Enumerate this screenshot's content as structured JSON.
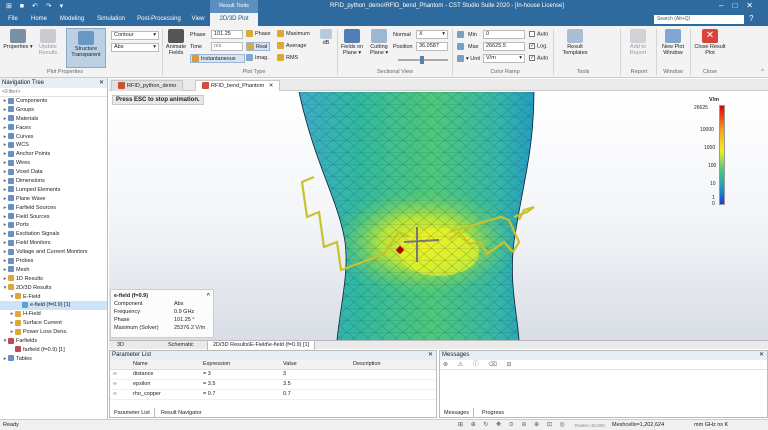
{
  "window": {
    "title": "RFID_python_demo\\RFID_bend_Phantom - CST Studio Suite 2020 - [In-house License]",
    "context_tab": "Result Tools",
    "quick_access": "⊞ ■ ↶ ↷ ▾"
  },
  "menu": {
    "tabs": [
      "File",
      "Home",
      "Modeling",
      "Simulation",
      "Post-Processing",
      "View",
      "2D/3D Plot"
    ],
    "search_placeholder": "Search (Alt+Q)"
  },
  "ribbon": {
    "plot_properties": {
      "properties": "Properties",
      "update_results": "Update Results",
      "structure_transparent": "Structure Transparent",
      "plot_type_select": "Contour",
      "scale_select": "Abs",
      "group": "Plot Properties"
    },
    "plot_type": {
      "animate_fields": "Animate Fields",
      "phase_label": "Phase",
      "phase_value": "101.25",
      "time_label": "Time",
      "time_value": "n/s",
      "instantaneous": "Instantaneous",
      "phase_btn": "Phase",
      "real_btn": "Real",
      "imag_btn": "Imag.",
      "maximum_btn": "Maximum",
      "average_btn": "Average",
      "rms_btn": "RMS",
      "db_btn": "dB",
      "group": "Plot Type"
    },
    "sectional_view": {
      "fields_on_plane": "Fields on Plane",
      "cutting_plane": "Cutting Plane",
      "normal_label": "Normal",
      "normal_value": "X",
      "position_label": "Position",
      "position_value": "36.0587",
      "group": "Sectional View"
    },
    "color_ramp": {
      "min_label": "Min",
      "min_value": "0",
      "max_label": "Max",
      "max_value": "26625.5",
      "unit_label": "Unit",
      "unit_value": "V/m",
      "auto_label": "Auto",
      "log_label": "Log.",
      "log_checked": true,
      "auto2_label": "Auto",
      "auto2_checked": true,
      "group": "Color Ramp"
    },
    "tools": {
      "result_templates": "Result Templates",
      "group": "Tools"
    },
    "report": {
      "add_to_report": "Add to Report",
      "group": "Report"
    },
    "window": {
      "new_plot_window": "New Plot Window",
      "group": "Window"
    },
    "close": {
      "close_result_plot": "Close Result Plot",
      "group": "Close"
    }
  },
  "navtree": {
    "title": "Navigation Tree",
    "filter": "<Filter>",
    "items": [
      {
        "label": "Components",
        "color": "#6b8fc2"
      },
      {
        "label": "Groups",
        "color": "#6b8fc2"
      },
      {
        "label": "Materials",
        "color": "#6b8fc2"
      },
      {
        "label": "Faces",
        "color": "#6b8fc2"
      },
      {
        "label": "Curves",
        "color": "#6b8fc2"
      },
      {
        "label": "WCS",
        "color": "#6b8fc2"
      },
      {
        "label": "Anchor Points",
        "color": "#6b8fc2"
      },
      {
        "label": "Wires",
        "color": "#6b8fc2"
      },
      {
        "label": "Voxel Data",
        "color": "#6b8fc2"
      },
      {
        "label": "Dimensions",
        "color": "#6b8fc2"
      },
      {
        "label": "Lumped Elements",
        "color": "#6b8fc2"
      },
      {
        "label": "Plane Wave",
        "color": "#6b8fc2"
      },
      {
        "label": "Farfield Sources",
        "color": "#6b8fc2"
      },
      {
        "label": "Field Sources",
        "color": "#6b8fc2"
      },
      {
        "label": "Ports",
        "color": "#6b8fc2"
      },
      {
        "label": "Excitation Signals",
        "color": "#6b8fc2"
      },
      {
        "label": "Field Monitors",
        "color": "#6b8fc2"
      },
      {
        "label": "Voltage and Current Monitors",
        "color": "#6b8fc2"
      },
      {
        "label": "Probes",
        "color": "#6b8fc2"
      },
      {
        "label": "Mesh",
        "color": "#6b8fc2"
      },
      {
        "label": "1D Results",
        "color": "#d9a93a"
      },
      {
        "label": "2D/3D Results",
        "color": "#d9a93a"
      },
      {
        "label": "E-Field",
        "color": "#d9a93a"
      },
      {
        "label": "e-field (f=0.9) [1]",
        "color": "#5aa0d8"
      },
      {
        "label": "H-Field",
        "color": "#d9a93a"
      },
      {
        "label": "Surface Current",
        "color": "#d9a93a"
      },
      {
        "label": "Power Loss Dens.",
        "color": "#d9a93a"
      },
      {
        "label": "Farfields",
        "color": "#c24a4a"
      },
      {
        "label": "farfield (f=0.9) [1]",
        "color": "#c24a4a"
      },
      {
        "label": "Tables",
        "color": "#6b8fc2"
      }
    ]
  },
  "doctabs": [
    "RFID_python_demo",
    "RFID_bend_Phantom"
  ],
  "viewport": {
    "esc_hint": "Press ESC to stop animation.",
    "legend": {
      "unit": "V/m",
      "ticks": [
        "26625",
        "10000",
        "1000",
        "100",
        "10",
        "1",
        "0"
      ]
    },
    "info": {
      "title": "e-field (f=0.9)",
      "rows": [
        {
          "k": "Component",
          "v": "Abs"
        },
        {
          "k": "Frequency",
          "v": "0.9 GHz"
        },
        {
          "k": "Phase",
          "v": "101.25 °"
        },
        {
          "k": "Maximum (Solver)",
          "v": "25376.2 V/m"
        }
      ]
    }
  },
  "viewtabs": [
    "3D",
    "Schematic",
    "2D/3D Results\\E-Field\\e-field (f=0.9) [1]"
  ],
  "params": {
    "title": "Parameter List",
    "columns": [
      "Name",
      "Expression",
      "Value",
      "Description"
    ],
    "rows": [
      {
        "name": "distance",
        "expr": "= 3",
        "value": "3"
      },
      {
        "name": "epsilon",
        "expr": "= 3.5",
        "value": "3.5"
      },
      {
        "name": "rho_copper",
        "expr": "= 0.7",
        "value": "0.7"
      }
    ],
    "tabs": [
      "Parameter List",
      "Result Navigator"
    ]
  },
  "messages": {
    "title": "Messages",
    "tools": "⊗ ⚠ ⓘ ⌫ ⊟",
    "tabs": [
      "Messages",
      "Progress"
    ]
  },
  "status": {
    "ready": "Ready",
    "tools": "⊞ ⊕ ↻ ✥ ⊙ ⊖ ⊕ ⊡ ◎",
    "raster": "Raster=10.000",
    "meshcells": "Meshcells=1,202,624",
    "units": "mm GHz ns K"
  }
}
